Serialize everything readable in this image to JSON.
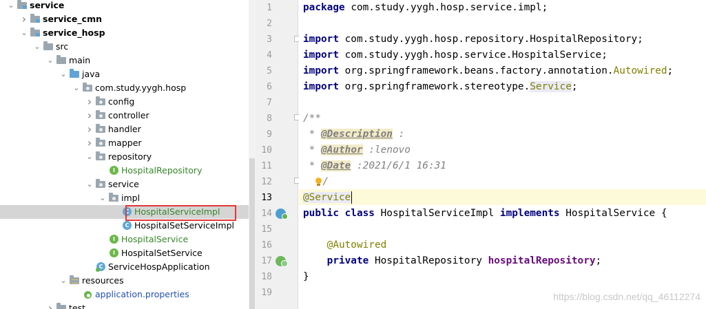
{
  "tree": {
    "items": [
      {
        "label": "service",
        "style": "bold",
        "icon": "module-folder-icon",
        "arrow": "expanded"
      },
      {
        "label": "service_cmn",
        "style": "bold",
        "icon": "module-folder-icon",
        "arrow": "collapsed"
      },
      {
        "label": "service_hosp",
        "style": "bold",
        "icon": "module-folder-icon",
        "arrow": "expanded"
      },
      {
        "label": "src",
        "style": "normal",
        "icon": "folder-icon",
        "arrow": "expanded"
      },
      {
        "label": "main",
        "style": "normal",
        "icon": "folder-icon",
        "arrow": "expanded"
      },
      {
        "label": "java",
        "style": "normal",
        "icon": "source-folder-icon",
        "arrow": "expanded"
      },
      {
        "label": "com.study.yygh.hosp",
        "style": "normal",
        "icon": "package-icon",
        "arrow": "expanded"
      },
      {
        "label": "config",
        "style": "normal",
        "icon": "package-icon",
        "arrow": "collapsed"
      },
      {
        "label": "controller",
        "style": "normal",
        "icon": "package-icon",
        "arrow": "collapsed"
      },
      {
        "label": "handler",
        "style": "normal",
        "icon": "package-icon",
        "arrow": "collapsed"
      },
      {
        "label": "mapper",
        "style": "normal",
        "icon": "package-icon",
        "arrow": "collapsed"
      },
      {
        "label": "repository",
        "style": "normal",
        "icon": "package-icon",
        "arrow": "expanded"
      },
      {
        "label": "HospitalRepository",
        "style": "green",
        "icon": "interface-icon",
        "arrow": "none"
      },
      {
        "label": "service",
        "style": "normal",
        "icon": "package-icon",
        "arrow": "expanded"
      },
      {
        "label": "impl",
        "style": "normal",
        "icon": "package-icon",
        "arrow": "expanded"
      },
      {
        "label": "HospitalServiceImpl",
        "style": "green",
        "icon": "class-icon",
        "arrow": "none",
        "selected": true
      },
      {
        "label": "HospitalSetServiceImpl",
        "style": "normal",
        "icon": "class-icon",
        "arrow": "none"
      },
      {
        "label": "HospitalService",
        "style": "green",
        "icon": "interface-icon",
        "arrow": "none"
      },
      {
        "label": "HospitalSetService",
        "style": "normal",
        "icon": "interface-icon",
        "arrow": "none"
      },
      {
        "label": "ServiceHospApplication",
        "style": "normal",
        "icon": "spring-boot-class-icon",
        "arrow": "none"
      },
      {
        "label": "resources",
        "style": "normal",
        "icon": "resources-folder-icon",
        "arrow": "expanded"
      },
      {
        "label": "application.properties",
        "style": "blue",
        "icon": "properties-file-icon",
        "arrow": "none"
      },
      {
        "label": "test",
        "style": "normal",
        "icon": "folder-icon",
        "arrow": "collapsed"
      }
    ]
  },
  "editor": {
    "line_numbers": [
      "1",
      "2",
      "3",
      "4",
      "5",
      "6",
      "7",
      "8",
      "9",
      "10",
      "11",
      "12",
      "13",
      "14",
      "15",
      "16",
      "17",
      "18",
      "19"
    ],
    "lines": {
      "l1_kw": "package",
      "l1_rest": " com.study.yygh.hosp.service.impl;",
      "l3_kw": "import",
      "l3_rest": " com.study.yygh.hosp.repository.HospitalRepository;",
      "l4_kw": "import",
      "l4_rest": " com.study.yygh.hosp.service.HospitalService;",
      "l5_kw": "import",
      "l5_rest": " org.springframework.beans.factory.annotation.",
      "l5_ann": "Autowired",
      "l5_end": ";",
      "l6_kw": "import",
      "l6_rest": " org.springframework.stereotype.",
      "l6_ann": "Service",
      "l6_end": ";",
      "l8": "/**",
      "l9_pre": " * ",
      "l9_tag": "@Description",
      "l9_rest": " :",
      "l10_pre": " * ",
      "l10_tag": "@Author",
      "l10_rest": " :lenovo",
      "l11_pre": " * ",
      "l11_tag": "@Date",
      "l11_rest": " :2021/6/1 16:31",
      "l12": "/",
      "l13": "@Service",
      "l14_kw1": "public class",
      "l14_name": " HospitalServiceImpl ",
      "l14_kw2": "implements",
      "l14_rest": " HospitalService {",
      "l16": "@Autowired",
      "l17_kw": "private",
      "l17_type": " HospitalRepository ",
      "l17_field": "hospitalRepository",
      "l17_end": ";",
      "l18": "}"
    }
  },
  "watermark": "https://blog.csdn.net/qq_46112274",
  "colors": {
    "keyword": "#000080",
    "annotation": "#808000",
    "interface_green": "#36862a",
    "selection_border": "#e53535"
  }
}
